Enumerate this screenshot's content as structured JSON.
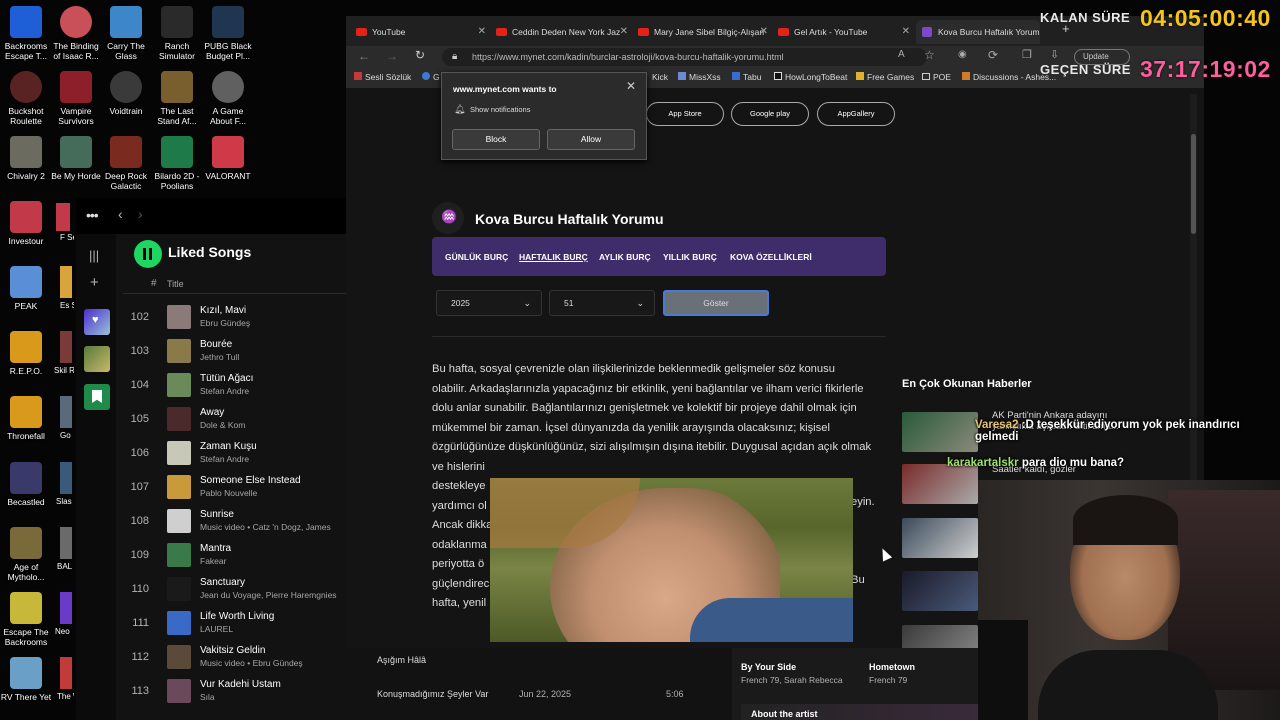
{
  "desktop_icons": [
    {
      "label": "Backrooms Escape T...",
      "color": "#1e5fd7"
    },
    {
      "label": "The Binding of Isaac R...",
      "color": "#c94f58"
    },
    {
      "label": "Carry The Glass",
      "color": "#3d87c8"
    },
    {
      "label": "Ranch Simulator",
      "color": "#2a2a2a"
    },
    {
      "label": "PUBG Black Budget Pl...",
      "color": "#1f3550"
    },
    {
      "label": "Buckshot Roulette",
      "color": "#5a2323"
    },
    {
      "label": "Vampire Survivors",
      "color": "#8c1f2a"
    },
    {
      "label": "Voidtrain",
      "color": "#3a3a3a"
    },
    {
      "label": "The Last Stand Af...",
      "color": "#7a5f2e"
    },
    {
      "label": "A Game About F...",
      "color": "#606060"
    },
    {
      "label": "Chivalry 2",
      "color": "#6b6b60"
    },
    {
      "label": "Be My Horde",
      "color": "#456b5a"
    },
    {
      "label": "Deep Rock Galactic",
      "color": "#7a2a1e"
    },
    {
      "label": "Bilardo 2D - Poolians",
      "color": "#1f7a4a"
    },
    {
      "label": "VALORANT",
      "color": "#cf3a49"
    },
    {
      "label": "Investour",
      "color": "#c23a4a"
    },
    {
      "label": "PEAK",
      "color": "#5a8fd6"
    },
    {
      "label": "R.E.P.O.",
      "color": "#d99a1b"
    },
    {
      "label": "Thronefall",
      "color": "#d99a1b"
    },
    {
      "label": "Becastled",
      "color": "#3a3a6a"
    },
    {
      "label": "Age of Mytholo...",
      "color": "#7a6a3a"
    },
    {
      "label": "Escape The Backrooms",
      "color": "#c8b83a"
    },
    {
      "label": "RV There Yet",
      "color": "#6aa0c8"
    }
  ],
  "partial_icons": [
    "F Se",
    "Es Sim",
    "Skil R",
    "Go",
    "Slas Fro",
    "BAL",
    "Neo",
    "The Wa"
  ],
  "timers": {
    "remaining_label": "KALAN SÜRE",
    "remaining_value": "04:05:00:40",
    "elapsed_label": "GEÇEN SÜRE",
    "elapsed_value": "37:17:19:02"
  },
  "spotify": {
    "playlist_title": "Liked Songs",
    "col_num": "#",
    "col_title": "Title",
    "rows": [
      {
        "num": "102",
        "title": "Kızıl, Mavi",
        "artist": "Ebru Gündeş",
        "color": "#8a7a7a"
      },
      {
        "num": "103",
        "title": "Bourée",
        "artist": "Jethro Tull",
        "color": "#8a7a4a"
      },
      {
        "num": "104",
        "title": "Tütün Ağacı",
        "artist": "Stefan Andre",
        "color": "#6a8a5a"
      },
      {
        "num": "105",
        "title": "Away",
        "artist": "Dole & Kom",
        "color": "#4a2a2a"
      },
      {
        "num": "106",
        "title": "Zaman Kuşu",
        "artist": "Stefan Andre",
        "color": "#c8c8b8"
      },
      {
        "num": "107",
        "title": "Someone Else Instead",
        "artist": "Pablo Nouvelle",
        "color": "#c89a3a"
      },
      {
        "num": "108",
        "title": "Sunrise",
        "artist": "Music video • Catz 'n Dogz, James",
        "color": "#cfcfcf"
      },
      {
        "num": "109",
        "title": "Mantra",
        "artist": "Fakear",
        "color": "#3a7a4a"
      },
      {
        "num": "110",
        "title": "Sanctuary",
        "artist": "Jean du Voyage, Pierre Haremgnies",
        "color": "#1a1a1a"
      },
      {
        "num": "111",
        "title": "Life Worth Living",
        "artist": "LAUREL",
        "color": "#3a6ac8"
      },
      {
        "num": "112",
        "title": "Vakitsiz Geldin",
        "artist": "Music video • Ebru Gündeş",
        "color": "#5a4a3a"
      },
      {
        "num": "113",
        "title": "Vur Kadehi Ustam",
        "artist": "Sıla",
        "color": "#6a4a5a"
      }
    ],
    "footer_rows": [
      {
        "title": "Aşığım Hâlâ",
        "date": "",
        "duration": ""
      },
      {
        "title": "Konuşmadığımız Şeyler Var",
        "date": "Jun 22, 2025",
        "duration": "5:06"
      }
    ],
    "related": [
      {
        "title": "By Your Side",
        "artist": "French 79, Sarah Rebecca"
      },
      {
        "title": "Hometown",
        "artist": "French 79"
      }
    ],
    "about_artist": "About the artist"
  },
  "browser": {
    "tabs": [
      {
        "label": "YouTube",
        "active": false
      },
      {
        "label": "Ceddin Deden New York Jaz",
        "active": false
      },
      {
        "label": "Mary Jane Sibel Bilgiç-Alışan",
        "active": false
      },
      {
        "label": "Gel Artık - YouTube",
        "active": false
      },
      {
        "label": "Kova Burcu Haftalık Yorumu",
        "active": true
      }
    ],
    "url": "https://www.mynet.com/kadin/burclar-astroloji/kova-burcu-haftalik-yorumu.html",
    "update_label": "Update",
    "bookmarks": [
      "Sesli Sözlük",
      "G",
      "Kick",
      "MissXss",
      "Tabu",
      "HowLongToBeat",
      "Free Games",
      "POE",
      "Discussions - Ashes..."
    ]
  },
  "popup": {
    "title": "www.mynet.com wants to",
    "permission": "Show notifications",
    "block": "Block",
    "allow": "Allow"
  },
  "page": {
    "stores": [
      "App Store",
      "Google play",
      "AppGallery"
    ],
    "heading": "Kova Burcu Haftalık Yorumu",
    "nav": [
      "GÜNLÜK BURÇ",
      "HAFTALIK BURÇ",
      "AYLIK BURÇ",
      "YILLIK BURÇ",
      "KOVA ÖZELLİKLERİ"
    ],
    "year": "2025",
    "week": "51",
    "show_button": "Göster",
    "paragraph_lines": [
      "Bu hafta, sosyal çevrenizle olan ilişkilerinizde beklenmedik gelişmeler söz konusu",
      "olabilir. Arkadaşlarınızla yapacağınız bir etkinlik, yeni bağlantılar ve ilham verici fikirlerle",
      "dolu anlar sunabilir. Bağlantılarınızı genişletmek ve kolektif bir projeye dahil olmak için",
      "mükemmel bir zaman. İçsel dünyanızda da yenilik arayışında olacaksınız; kişisel",
      "özgürlüğünüze düşkünlüğünüz, sizi alışılmışın dışına itebilir. Duygusal açıdan açık olmak",
      "ve hislerini",
      "destekleye",
      "yardımcı ol",
      "Ancak dikka",
      "odaklanma",
      "periyotta ö",
      "güçlendirec",
      "hafta, yenil"
    ],
    "right_fragments": [
      "eyin.",
      "Bu"
    ],
    "side_title": "En Çok Okunan Haberler",
    "news_1": "AK Parti'nin Ankara adayını yanlışlıkla açıkladı! Sitil ama...",
    "news_2": "Saatler kaldı, gözler"
  },
  "chat": [
    {
      "user": "Varesa2",
      "message": ":D teşekkür ediyorum yok pek inandırıcı gelmedi"
    },
    {
      "user": "karakartalskr",
      "message": "para dio mu bana?"
    }
  ]
}
